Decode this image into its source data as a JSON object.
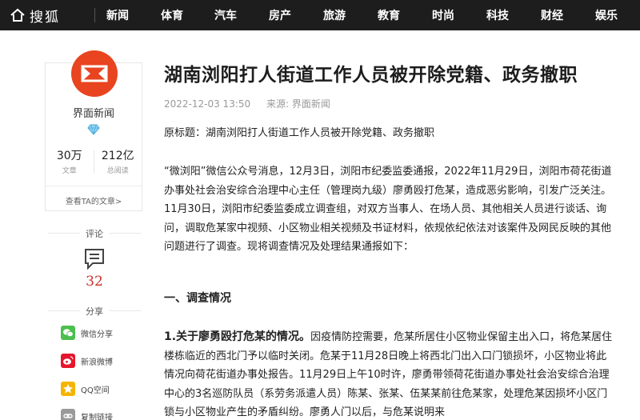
{
  "nav": {
    "brand": "搜狐",
    "items": [
      "新闻",
      "体育",
      "汽车",
      "房产",
      "旅游",
      "教育",
      "时尚",
      "科技",
      "财经",
      "娱乐"
    ]
  },
  "author": {
    "name": "界面新闻",
    "articles_count": "30万",
    "articles_label": "文章",
    "views_count": "212亿",
    "views_label": "总阅读",
    "see_articles": "查看TA的文章>"
  },
  "comments": {
    "label": "评论",
    "count": "32"
  },
  "share": {
    "label": "分享",
    "items": [
      "微信分享",
      "新浪微博",
      "QQ空间",
      "复制链接"
    ]
  },
  "article": {
    "title": "湖南浏阳打人街道工作人员被开除党籍、政务撤职",
    "date": "2022-12-03 13:50",
    "source": "来源: 界面新闻",
    "original_title": "原标题：湖南浏阳打人街道工作人员被开除党籍、政务撤职",
    "para1": "“微浏阳”微信公众号消息，12月3日，浏阳市纪委监委通报，2022年11月29日，浏阳市荷花街道办事处社会治安综合治理中心主任（管理岗九级）廖勇殴打危某，造成恶劣影响，引发广泛关注。11月30日，浏阳市纪委监委成立调查组，对双方当事人、在场人员、其他相关人员进行谈话、询问，调取危某家中视频、小区物业相关视频及书证材料，依规依纪依法对该案件及网民反映的其他问题进行了调查。现将调查情况及处理结果通报如下：",
    "section1": "一、调查情况",
    "point1_title": "1.关于廖勇殴打危某的情况。",
    "point1_text": "因疫情防控需要，危某所居住小区物业保留主出入口，将危某居住楼栋临近的西北门予以临时关闭。危某于11月28日晚上将西北门出入口门锁损坏，小区物业将此情况向荷花街道办事处报告。11月29日上午10时许，廖勇带领荷花街道办事处社会治安综合治理中心的3名巡防队员（系劳务派遣人员）陈某、张某、伍某某前往危某家，处理危某因损坏小区门锁与小区物业产生的矛盾纠纷。廖勇人门以后，与危某说明来"
  },
  "colors": {
    "nav_bg": "#1d1d1d",
    "logo_red": "#e8441f",
    "comment_red": "#c9302c",
    "wechat_green": "#4cbf4f",
    "weibo_red": "#e6162d",
    "qzone_yellow": "#f5b400",
    "link_gray": "#9a9a9a"
  }
}
